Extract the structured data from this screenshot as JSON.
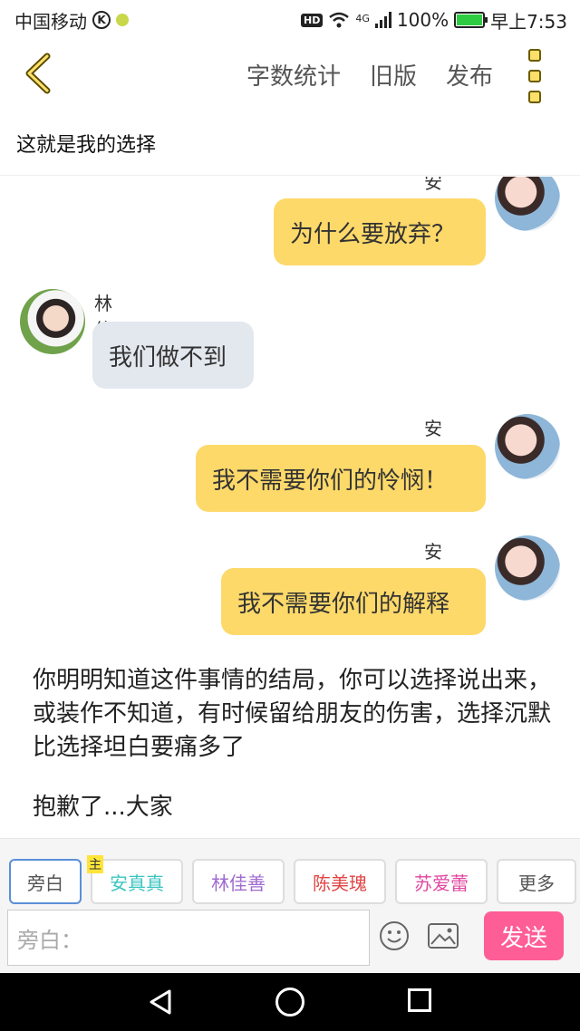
{
  "status_bar": {
    "carrier": "中国移动",
    "network": "4G",
    "battery": "100%",
    "time": "早上7:53"
  },
  "toolbar": {
    "word_count": "字数统计",
    "old_version": "旧版",
    "publish": "发布"
  },
  "doc_title": "这就是我的选择",
  "messages": [
    {
      "speaker": "安真真",
      "text": "为什么要放弃？",
      "side": "right"
    },
    {
      "speaker": "林佳善",
      "text": "我们做不到",
      "side": "left"
    },
    {
      "speaker": "安真真",
      "text": "我不需要你们的怜悯！",
      "side": "right"
    },
    {
      "speaker": "安真真",
      "text": "我不需要你们的解释",
      "side": "right"
    }
  ],
  "narration": [
    "你明明知道这件事情的结局，你可以选择说出来，或装作不知道，有时候留给朋友的伤害，选择沉默比选择坦白要痛多了",
    "抱歉了...大家"
  ],
  "roles": [
    {
      "label": "旁白",
      "color": "#555555"
    },
    {
      "label": "安真真",
      "color": "#3cc5c0",
      "tag": "主"
    },
    {
      "label": "林佳善",
      "color": "#a06bd0"
    },
    {
      "label": "陈美瑰",
      "color": "#e24545"
    },
    {
      "label": "苏爱蕾",
      "color": "#e045a0"
    },
    {
      "label": "更多",
      "color": "#555555"
    }
  ],
  "input": {
    "placeholder": "旁白：",
    "send": "发送"
  }
}
